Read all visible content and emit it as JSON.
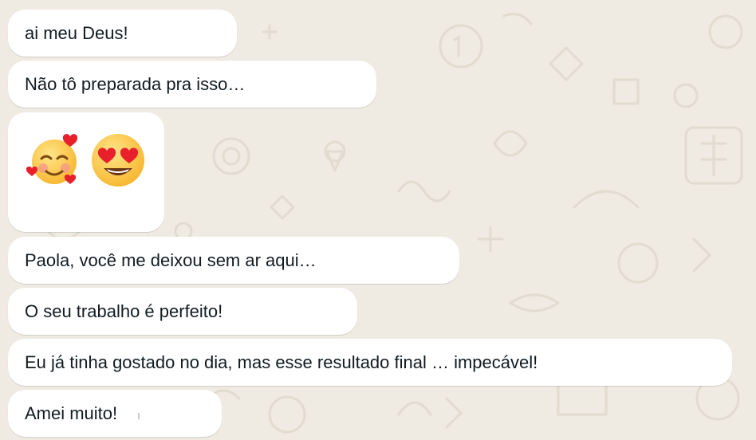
{
  "chat": {
    "background_color": "#efeae2",
    "bubble_color": "#ffffff",
    "messages": [
      {
        "text": "ai meu Deus!"
      },
      {
        "text": "Não tô preparada pra isso…"
      },
      {
        "emojis": [
          "smiling-face-with-hearts",
          "smiling-face-with-heart-eyes"
        ]
      },
      {
        "text": "Paola, você me deixou sem ar aqui…"
      },
      {
        "text": "O seu trabalho é perfeito!"
      },
      {
        "text": "Eu já tinha gostado no dia, mas esse resultado final … impecável!"
      },
      {
        "text": "Amei muito!"
      }
    ]
  }
}
